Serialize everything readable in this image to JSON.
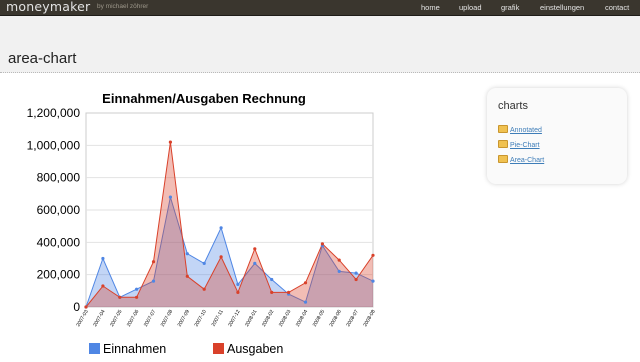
{
  "header": {
    "logo": "moneymaker",
    "byline": "by michael zöhrer",
    "nav": [
      "home",
      "upload",
      "grafik",
      "einstellungen",
      "contact"
    ]
  },
  "page": {
    "title": "area-chart"
  },
  "sidebar": {
    "title": "charts",
    "links": [
      "Annotated",
      "Pie-Chart",
      "Area-Chart"
    ]
  },
  "colors": {
    "series_einnahmen": "#4f86e4",
    "series_ausgaben": "#d9412a",
    "topbar": "#3a362e"
  },
  "chart_data": {
    "type": "area",
    "title": "Einnahmen/Ausgaben Rechnung",
    "x": [
      "2007-03",
      "2007-04",
      "2007-05",
      "2007-06",
      "2007-07",
      "2007-08",
      "2007-09",
      "2007-10",
      "2007-11",
      "2007-12",
      "2008-01",
      "2008-02",
      "2008-03",
      "2008-04",
      "2008-05",
      "2008-06",
      "2008-07",
      "2008-08"
    ],
    "series": [
      {
        "name": "Einnahmen",
        "values": [
          0,
          300000,
          60000,
          110000,
          160000,
          680000,
          330000,
          270000,
          490000,
          140000,
          270000,
          170000,
          80000,
          30000,
          380000,
          220000,
          210000,
          160000
        ]
      },
      {
        "name": "Ausgaben",
        "values": [
          0,
          130000,
          60000,
          60000,
          280000,
          1020000,
          190000,
          110000,
          310000,
          90000,
          360000,
          90000,
          90000,
          150000,
          390000,
          290000,
          170000,
          320000
        ]
      }
    ],
    "yticks": [
      "0",
      "200,000",
      "400,000",
      "600,000",
      "800,000",
      "1,000,000",
      "1,200,000"
    ],
    "ylim": [
      0,
      1200000
    ],
    "grid": true,
    "legend": "bottom"
  }
}
